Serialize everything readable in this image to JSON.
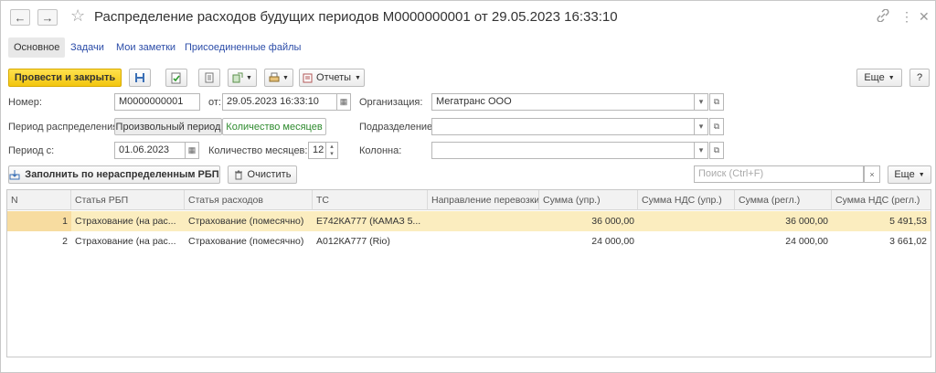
{
  "window": {
    "title": "Распределение расходов будущих периодов М0000000001 от 29.05.2023 16:33:10",
    "back_icon": "←",
    "forward_icon": "→",
    "star_icon": "☆",
    "link_icon": "🔗",
    "more_icon": "⋮",
    "close_icon": "✕"
  },
  "tabs": [
    {
      "label": "Основное"
    },
    {
      "label": "Задачи"
    },
    {
      "label": "Мои заметки"
    },
    {
      "label": "Присоединенные файлы"
    }
  ],
  "toolbar": {
    "post_close": "Провести и закрыть",
    "reports": "Отчеты",
    "more": "Еще",
    "help": "?"
  },
  "form": {
    "number_label": "Номер:",
    "number_value": "М0000000001",
    "date_label": "от:",
    "date_value": "29.05.2023 16:33:10",
    "org_label": "Организация:",
    "org_value": "Мегатранс ООО",
    "period_dist_label": "Период распределения:",
    "toggle_arbitrary": "Произвольный период",
    "toggle_months": "Количество месяцев",
    "dept_label": "Подразделение:",
    "dept_value": "",
    "period_from_label": "Период с:",
    "period_from_value": "01.06.2023",
    "months_label": "Количество месяцев:",
    "months_value": "12",
    "column_label": "Колонна:",
    "column_value": ""
  },
  "table_toolbar": {
    "fill_button": "Заполнить по нераспределенным РБП",
    "clear_button": "Очистить",
    "search_placeholder": "Поиск (Ctrl+F)",
    "more": "Еще"
  },
  "table": {
    "columns": [
      "N",
      "Статья РБП",
      "Статья расходов",
      "ТС",
      "Направление перевозки",
      "Сумма (упр.)",
      "Сумма НДС (упр.)",
      "Сумма (регл.)",
      "Сумма НДС (регл.)"
    ],
    "rows": [
      [
        "1",
        "Страхование (на рас...",
        "Страхование (помесячно)",
        "Е742КА777 (КАМАЗ 5...",
        "",
        "36 000,00",
        "",
        "36 000,00",
        "5 491,53"
      ],
      [
        "2",
        "Страхование (на рас...",
        "Страхование (помесячно)",
        "А012КА777 (Rio)",
        "",
        "24 000,00",
        "",
        "24 000,00",
        "3 661,02"
      ]
    ]
  }
}
